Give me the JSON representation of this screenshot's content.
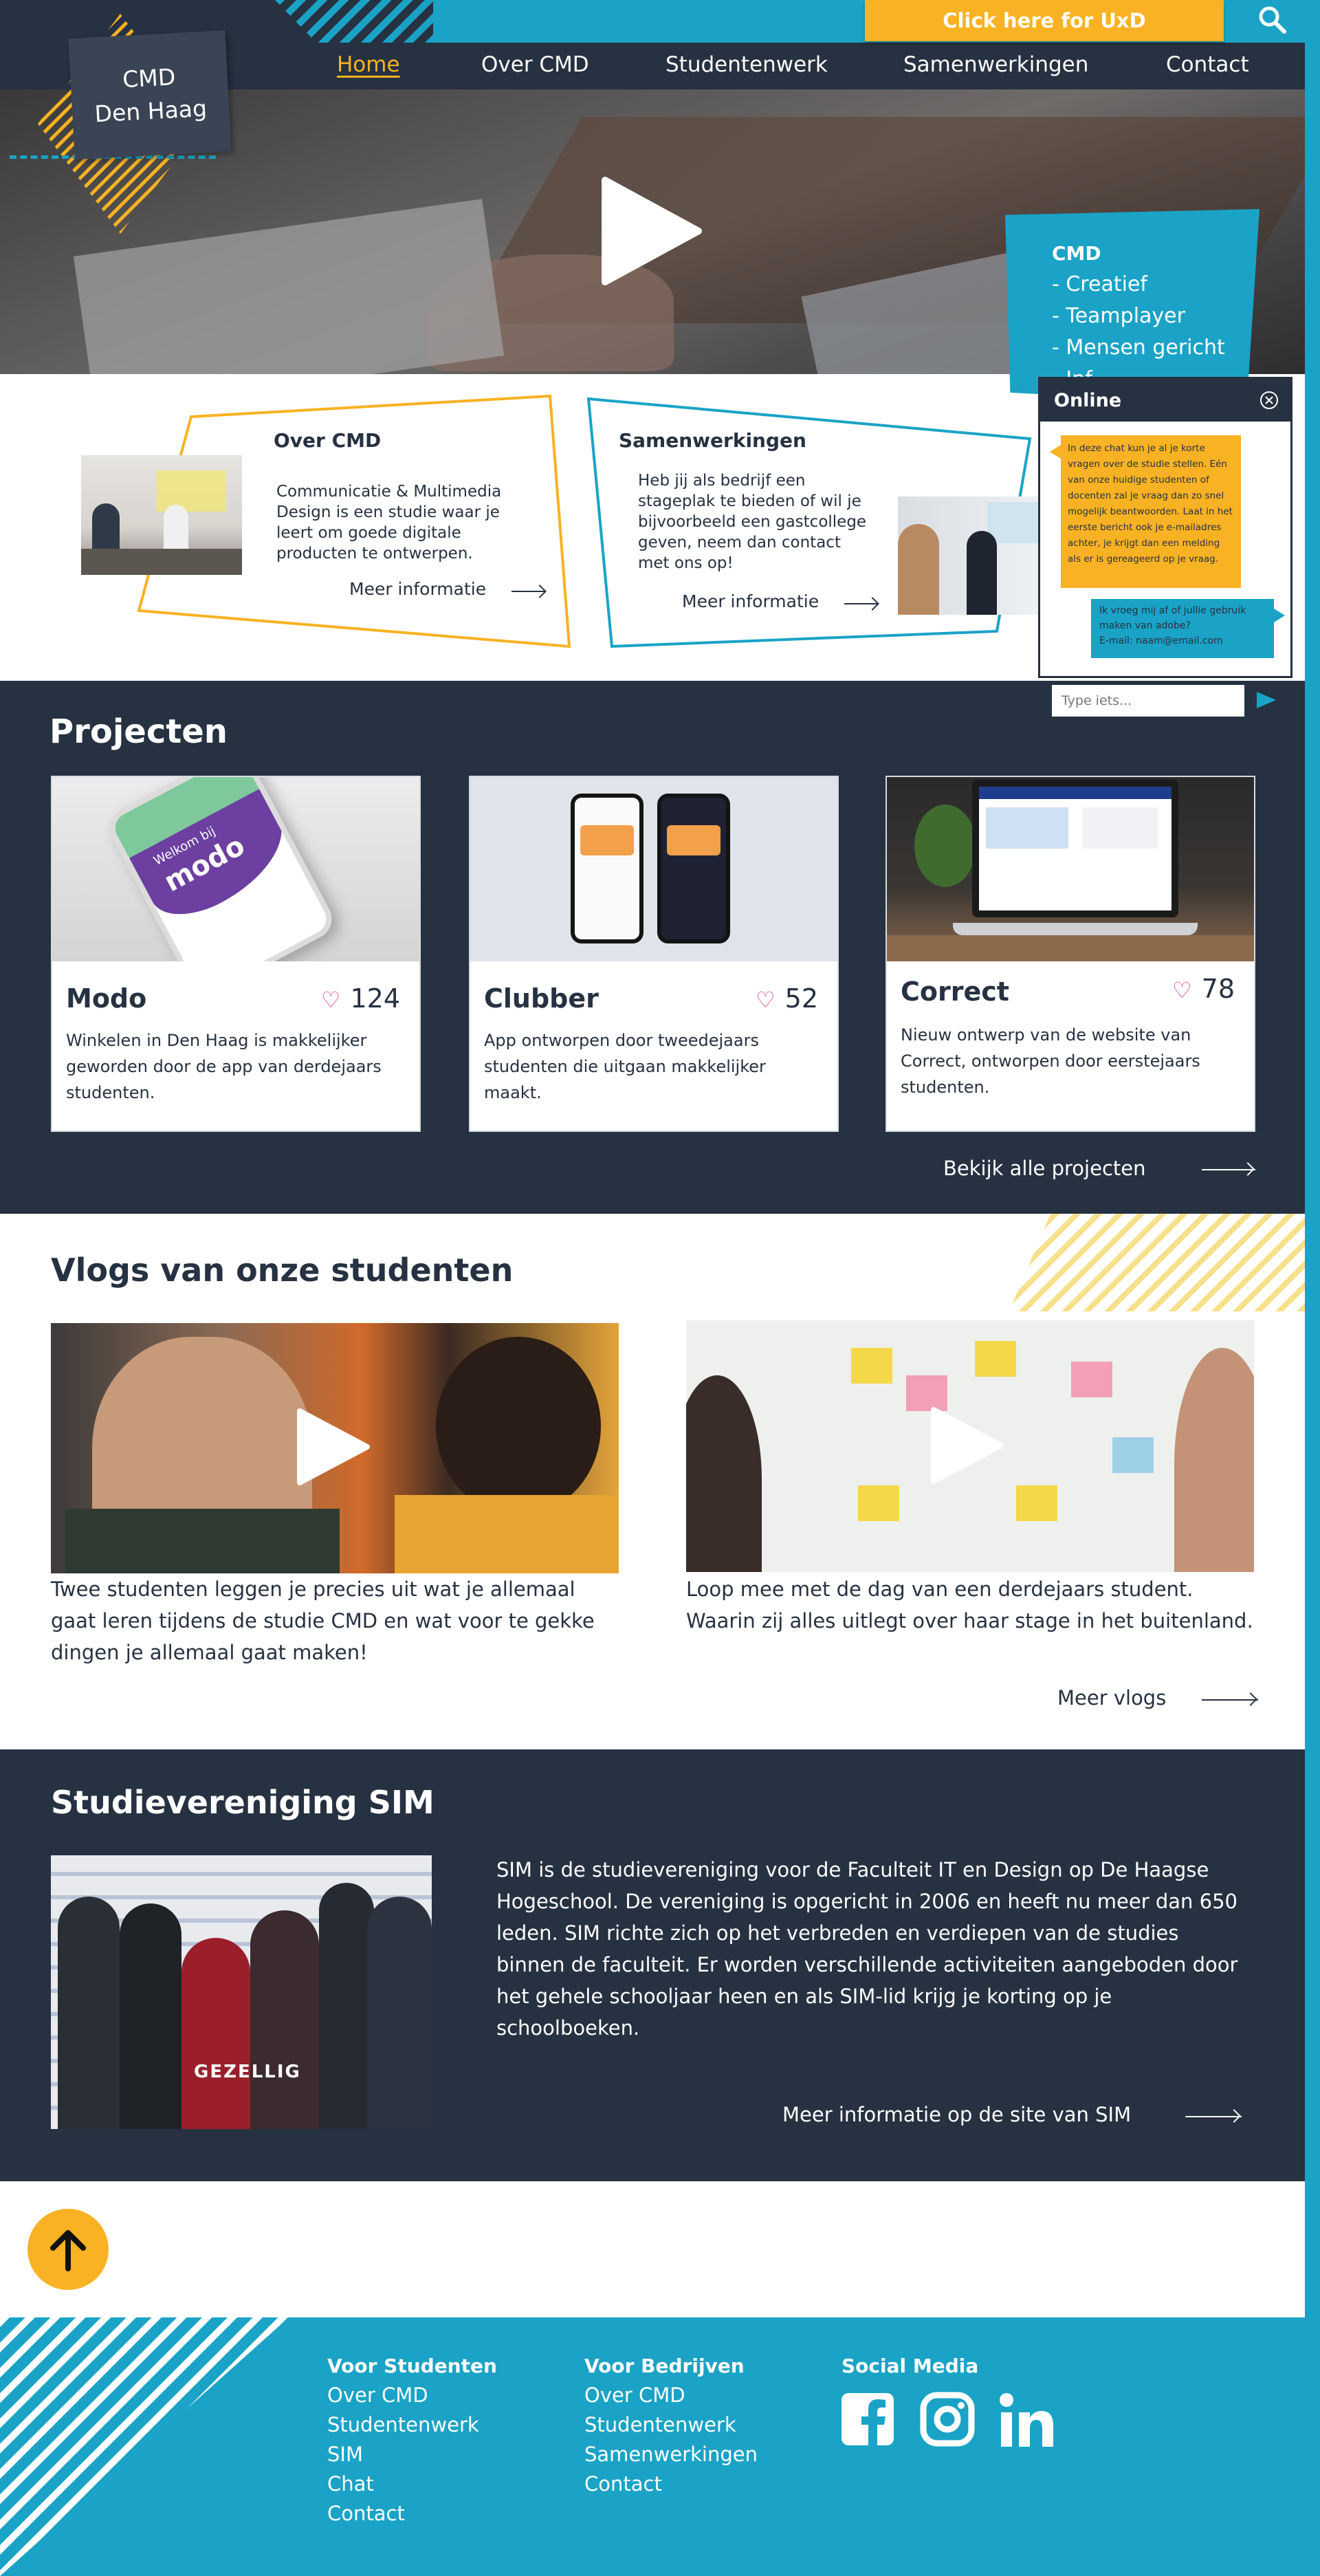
{
  "header": {
    "logo_line1": "CMD",
    "logo_line2": "Den Haag",
    "uxd_button": "Click here for UxD",
    "nav": [
      "Home",
      "Over CMD",
      "Studentenwerk",
      "Samenwerkingen",
      "Contact"
    ],
    "active_nav": "Home"
  },
  "hero": {
    "cmd_title": "CMD",
    "cmd_items": [
      "- Creatief",
      "- Teamplayer",
      "- Mensen gericht",
      "- Inf..."
    ]
  },
  "intro": {
    "over": {
      "title": "Over CMD",
      "text": "Communicatie & Multimedia Design is een studie waar je leert om goede digitale producten te ontwerpen.",
      "link": "Meer informatie"
    },
    "samen": {
      "title": "Samenwerkingen",
      "text": "Heb jij als bedrijf een stageplak te bieden of wil je bijvoorbeeld een gastcollege geven, neem dan contact met ons op!",
      "link": "Meer informatie"
    }
  },
  "chat": {
    "title": "Online",
    "bot_message": "In deze chat kun je al je korte vragen over de studie stellen. Eén van onze huidige studenten of docenten zal je vraag dan zo snel mogelijk beantwoorden. Laat in het eerste bericht ook je e-mailadres achter, je krijgt dan een melding als er is gereageerd op je vraag.",
    "user_message_line1": "Ik vroeg mij af of jullie gebruik maken van adobe?",
    "user_message_line2": "E-mail: naam@email.com",
    "input_placeholder": "Type iets..."
  },
  "projects": {
    "title": "Projecten",
    "cards": [
      {
        "title": "Modo",
        "likes": "124",
        "desc": "Winkelen in Den Haag is makkelijker geworden door de app van derdejaars studenten.",
        "phone_text": "modo",
        "phone_sub": "Welkom bij"
      },
      {
        "title": "Clubber",
        "likes": "52",
        "desc": "App ontworpen door tweedejaars studenten die uitgaan makkelijker maakt."
      },
      {
        "title": "Correct",
        "likes": "78",
        "desc": "Nieuw ontwerp van de website van Correct, ontworpen door eerstejaars studenten."
      }
    ],
    "all_link": "Bekijk alle projecten"
  },
  "vlogs": {
    "title": "Vlogs van onze studenten",
    "items": [
      {
        "desc": "Twee studenten leggen je precies uit wat je allemaal gaat leren tijdens de studie CMD en wat voor te gekke dingen je allemaal gaat maken!"
      },
      {
        "desc": "Loop mee met de dag van een derdejaars student. Waarin zij alles uitlegt over haar stage in het buitenland."
      }
    ],
    "more_link": "Meer vlogs"
  },
  "sim": {
    "title": "Studievereniging SIM",
    "photo_caption": "GEZELLIG",
    "text": "SIM is de studievereniging voor de Faculteit IT en Design op De Haagse Hogeschool. De vereniging is opgericht in 2006 en heeft nu meer dan 650 leden. SIM richte zich op het verbreden en verdiepen van de studies binnen de faculteit. Er worden verschillende activiteiten aangeboden door het gehele schooljaar heen en als SIM-lid krijg je korting op je schoolboeken.",
    "link": "Meer informatie op de site van SIM"
  },
  "footer": {
    "students": {
      "title": "Voor Studenten",
      "links": [
        "Over CMD",
        "Studentenwerk",
        "SIM",
        "Chat",
        "Contact"
      ]
    },
    "companies": {
      "title": "Voor Bedrijven",
      "links": [
        "Over CMD",
        "Studentenwerk",
        "Samenwerkingen",
        "Contact"
      ]
    },
    "social": {
      "title": "Social Media",
      "icons": [
        "facebook-icon",
        "instagram-icon",
        "linkedin-icon"
      ]
    }
  },
  "colors": {
    "dark": "#263141",
    "teal": "#1aa3c6",
    "yellow": "#f9b223",
    "heart": "#e0439c"
  }
}
